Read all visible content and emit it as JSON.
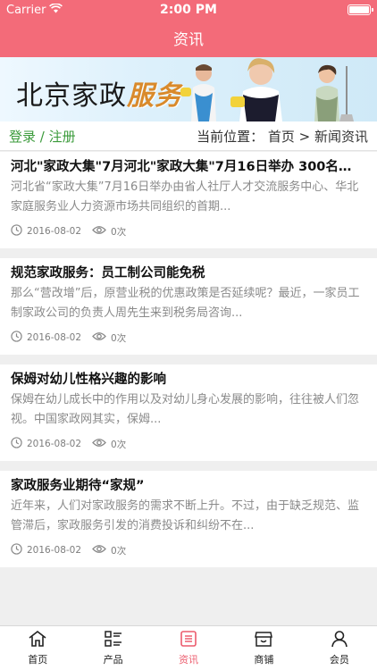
{
  "status": {
    "carrier": "Carrier",
    "time": "2:00 PM"
  },
  "nav": {
    "title": "资讯"
  },
  "banner": {
    "text_main": "北京家政",
    "text_highlight": "服务"
  },
  "location": {
    "login_text": "登录 / 注册",
    "breadcrumb": "当前位置：  首页 > 新闻资讯"
  },
  "articles": [
    {
      "title": "河北\"家政大集\"7月河北\"家政大集\"7月16日举办 300名…",
      "summary": "河北省“家政大集”7月16日举办由省人社厅人才交流服务中心、华北家庭服务业人力资源市场共同组织的首期...",
      "date": "2016-08-02",
      "views": "0次"
    },
    {
      "title": "规范家政服务：员工制公司能免税",
      "summary": "那么“营改增”后，原营业税的优惠政策是否延续呢？最近，一家员工制家政公司的负责人周先生来到税务局咨询...",
      "date": "2016-08-02",
      "views": "0次"
    },
    {
      "title": "保姆对幼儿性格兴趣的影响",
      "summary": "保姆在幼儿成长中的作用以及对幼儿身心发展的影响，往往被人们忽视。中国家政网其实，保姆...",
      "date": "2016-08-02",
      "views": "0次"
    },
    {
      "title": "家政服务业期待“家规”",
      "summary": "近年来，人们对家政服务的需求不断上升。不过，由于缺乏规范、监管滞后，家政服务引发的消费投诉和纠纷不在...",
      "date": "2016-08-02",
      "views": "0次"
    }
  ],
  "tabs": [
    {
      "label": "首页",
      "icon": "home-icon"
    },
    {
      "label": "产品",
      "icon": "grid-list-icon"
    },
    {
      "label": "资讯",
      "icon": "news-icon",
      "active": true
    },
    {
      "label": "商铺",
      "icon": "store-icon"
    },
    {
      "label": "会员",
      "icon": "user-icon"
    }
  ],
  "colors": {
    "accent": "#f36b79",
    "login_green": "#3b9b3b",
    "active_tab": "#ec5c6d"
  }
}
